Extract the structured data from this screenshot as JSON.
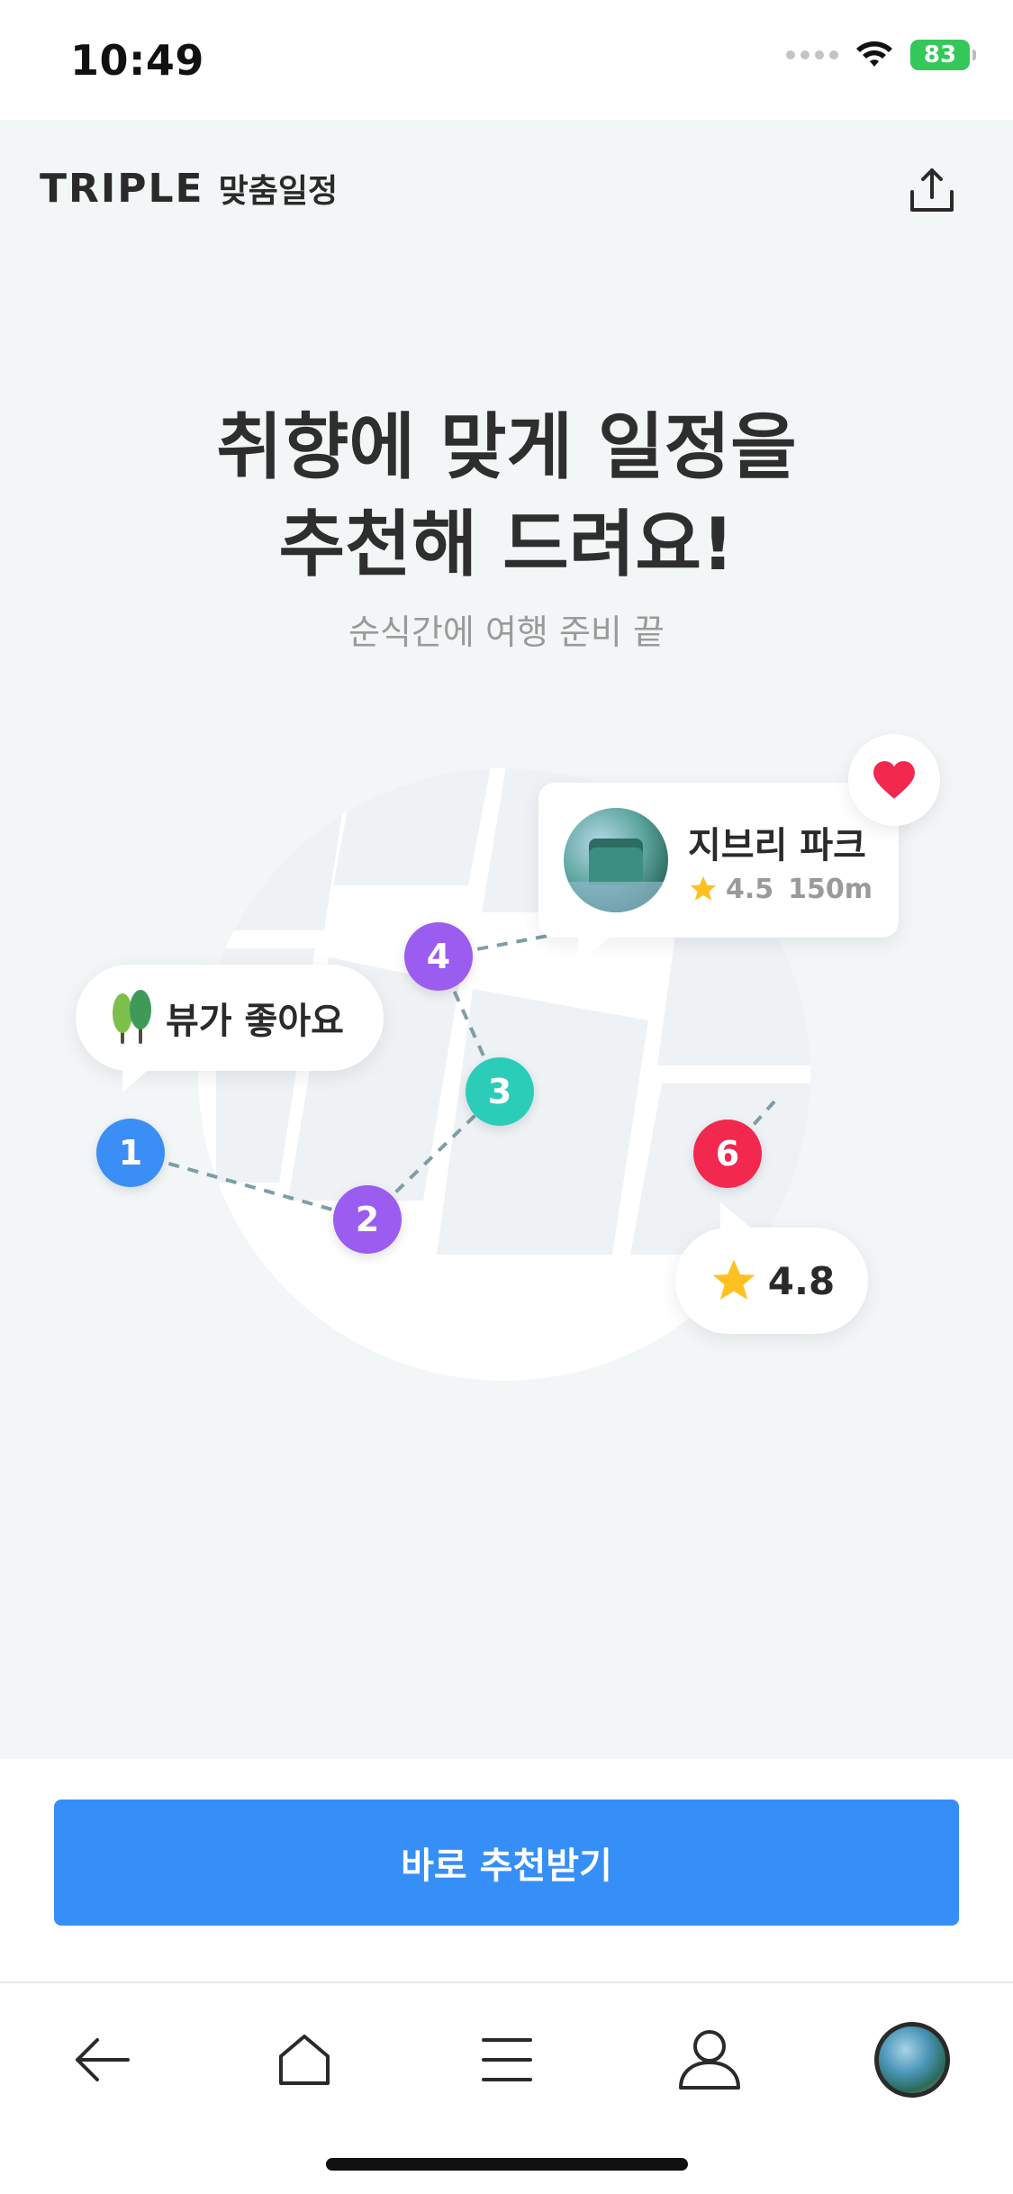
{
  "status_bar": {
    "time": "10:49",
    "battery": "83"
  },
  "header": {
    "brand": "TRIPLE",
    "subtitle": "맞춤일정",
    "share_icon": "share-icon"
  },
  "hero": {
    "title_line1": "취향에 맞게 일정을",
    "title_line2": "추천해 드려요!",
    "subtitle": "순식간에 여행 준비 끝"
  },
  "illustration": {
    "view_bubble": {
      "label": "뷰가 좋아요",
      "icon": "tree-icon"
    },
    "place_bubble": {
      "name": "지브리 파크",
      "rating": "4.5",
      "distance": "150m"
    },
    "rating_bubble": {
      "value": "4.8"
    },
    "pins": [
      "1",
      "2",
      "3",
      "4",
      "6"
    ],
    "colors": {
      "pin_blue": "#3b8ef6",
      "pin_purple": "#9b5cf0",
      "pin_teal": "#2ccdb8",
      "pin_red": "#f2284f",
      "heart": "#f2284f",
      "star": "#ffc021"
    }
  },
  "cta": {
    "label": "바로 추천받기",
    "color": "#368ff7"
  },
  "bottom_nav": {
    "items": [
      "back-arrow-icon",
      "home-icon",
      "menu-icon",
      "profile-icon",
      "avatar"
    ]
  }
}
